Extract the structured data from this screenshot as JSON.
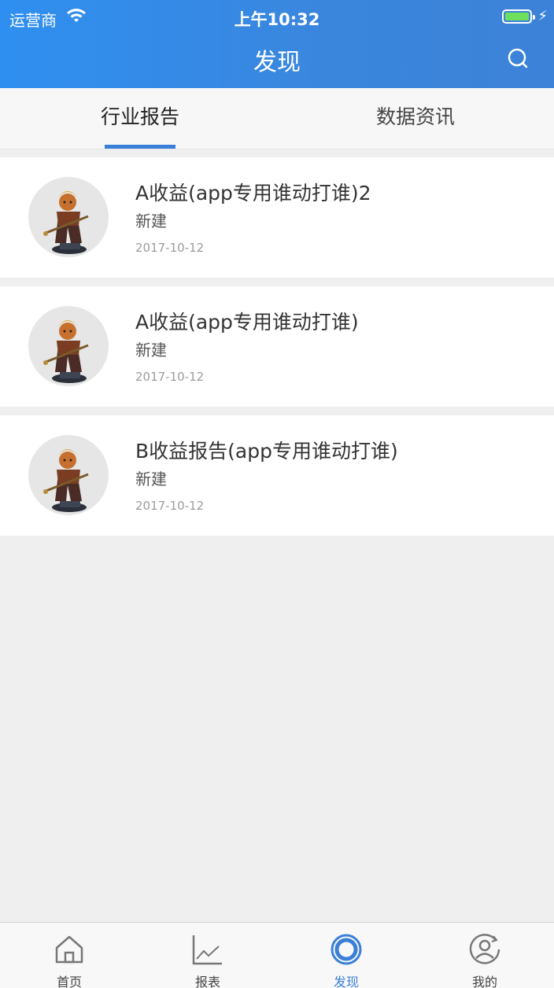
{
  "status_bar": {
    "carrier": "运营商",
    "time": "上午10:32",
    "battery_icon": "battery-icon",
    "wifi_icon": "wifi-icon"
  },
  "header": {
    "title": "发现",
    "search_icon": "search-icon"
  },
  "tabs": [
    {
      "label": "行业报告",
      "active": true
    },
    {
      "label": "数据资讯",
      "active": false
    }
  ],
  "reports": [
    {
      "title": "A收益(app专用谁动打谁)2",
      "status": "新建",
      "date": "2017-10-12"
    },
    {
      "title": "A收益(app专用谁动打谁)",
      "status": "新建",
      "date": "2017-10-12"
    },
    {
      "title": "B收益报告(app专用谁动打谁)",
      "status": "新建",
      "date": "2017-10-12"
    }
  ],
  "bottom_nav": [
    {
      "label": "首页",
      "icon": "home-icon",
      "active": false
    },
    {
      "label": "报表",
      "icon": "chart-icon",
      "active": false
    },
    {
      "label": "发现",
      "icon": "discover-icon",
      "active": true
    },
    {
      "label": "我的",
      "icon": "profile-icon",
      "active": false
    }
  ],
  "colors": {
    "primary": "#3a7fd8",
    "header_gradient_start": "#2f8ff0",
    "background": "#efefef"
  }
}
